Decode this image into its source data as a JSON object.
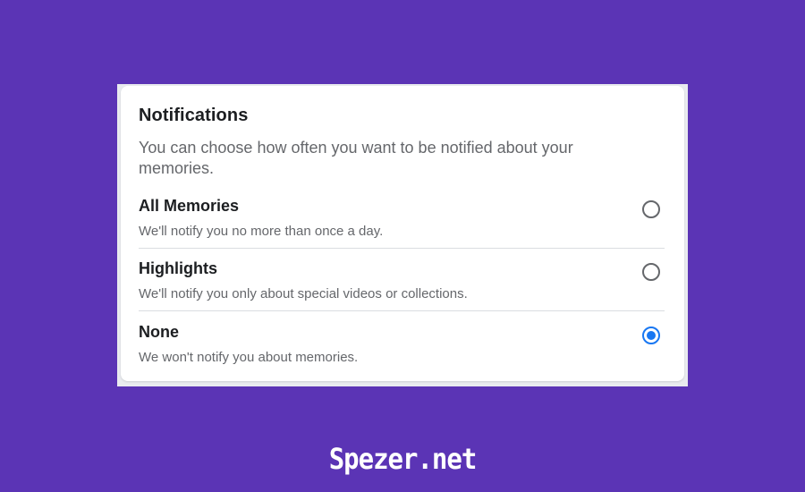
{
  "notifications": {
    "title": "Notifications",
    "description": "You can choose how often you want to be notified about your memories.",
    "options": [
      {
        "label": "All Memories",
        "description": "We'll notify you no more than once a day.",
        "selected": false
      },
      {
        "label": "Highlights",
        "description": "We'll notify you only about special videos or collections.",
        "selected": false
      },
      {
        "label": "None",
        "description": "We won't notify you about memories.",
        "selected": true
      }
    ]
  },
  "watermark": "Spezer.net",
  "colors": {
    "background": "#5b34b5",
    "accent": "#1877f2",
    "text_primary": "#1c1e21",
    "text_secondary": "#65676b"
  }
}
